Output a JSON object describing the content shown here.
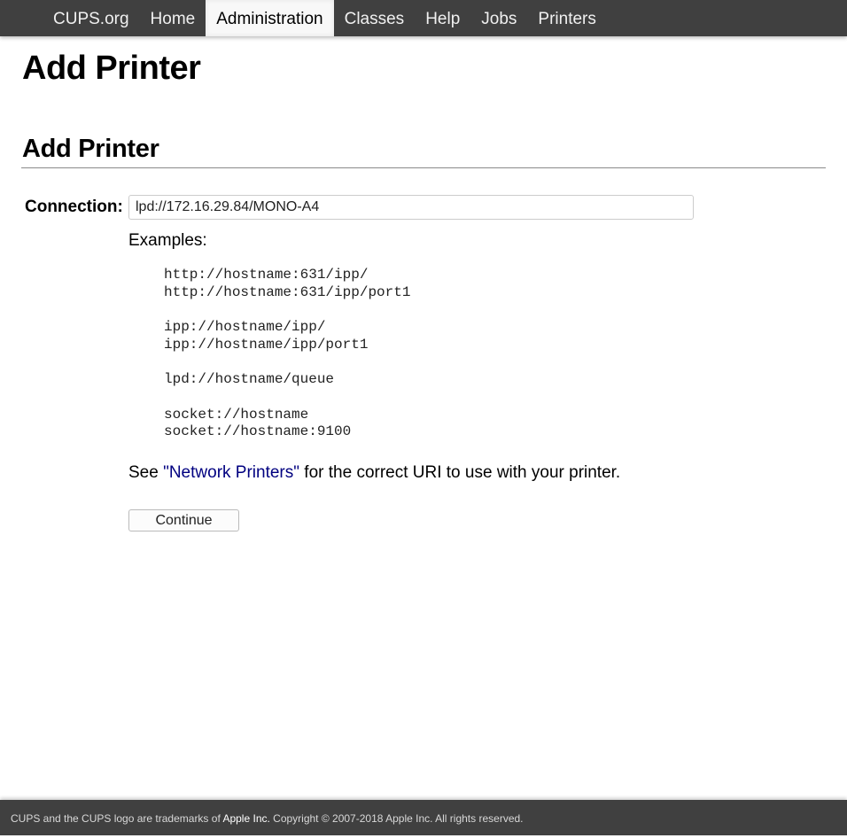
{
  "nav": {
    "items": [
      {
        "label": "CUPS.org",
        "active": false
      },
      {
        "label": "Home",
        "active": false
      },
      {
        "label": "Administration",
        "active": true
      },
      {
        "label": "Classes",
        "active": false
      },
      {
        "label": "Help",
        "active": false
      },
      {
        "label": "Jobs",
        "active": false
      },
      {
        "label": "Printers",
        "active": false
      }
    ]
  },
  "page_title": "Add Printer",
  "section_title": "Add Printer",
  "form": {
    "connection_label": "Connection:",
    "connection_value": "lpd://172.16.29.84/MONO-A4",
    "examples_label": "Examples:",
    "example_groups": [
      [
        "http://hostname:631/ipp/",
        "http://hostname:631/ipp/port1"
      ],
      [
        "ipp://hostname/ipp/",
        "ipp://hostname/ipp/port1"
      ],
      [
        "lpd://hostname/queue"
      ],
      [
        "socket://hostname",
        "socket://hostname:9100"
      ]
    ],
    "see_prefix": "See ",
    "see_link": "\"Network Printers\"",
    "see_suffix": " for the correct URI to use with your printer.",
    "continue_label": "Continue"
  },
  "footer": {
    "prefix": "CUPS and the CUPS logo are trademarks of ",
    "link": "Apple Inc.",
    "suffix": " Copyright © 2007-2018 Apple Inc. All rights reserved."
  },
  "colors": {
    "header_bg": "#404040",
    "link": "#000080"
  }
}
